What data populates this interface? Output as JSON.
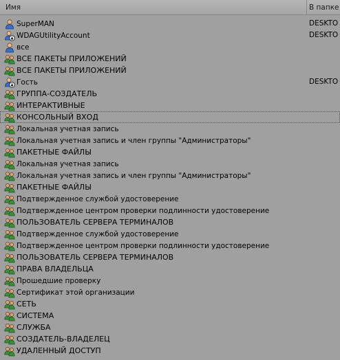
{
  "columns": {
    "name": "Имя",
    "folder": "В папке"
  },
  "rows": [
    {
      "name": "SuperMAN",
      "folder": "DESKTO",
      "icon": "user-icon"
    },
    {
      "name": "WDAGUtilityAccount",
      "folder": "DESKTO",
      "icon": "user-disabled-icon"
    },
    {
      "name": "все",
      "folder": "",
      "icon": "user-icon"
    },
    {
      "name": "ВСЕ ПАКЕТЫ ПРИЛОЖЕНИЙ",
      "folder": "",
      "icon": "group-icon"
    },
    {
      "name": "ВСЕ ПАКЕТЫ ПРИЛОЖЕНИЙ",
      "folder": "",
      "icon": "group-icon"
    },
    {
      "name": "Гость",
      "folder": "DESKTO",
      "icon": "user-disabled-icon"
    },
    {
      "name": "ГРУППА-СОЗДАТЕЛЬ",
      "folder": "",
      "icon": "group-icon"
    },
    {
      "name": "ИНТЕРАКТИВНЫЕ",
      "folder": "",
      "icon": "group-icon"
    },
    {
      "name": "КОНСОЛЬНЫЙ ВХОД",
      "folder": "",
      "icon": "group-icon"
    },
    {
      "name": "Локальная учетная запись",
      "folder": "",
      "icon": "group-icon"
    },
    {
      "name": "Локальная учетная запись и член группы \"Администраторы\"",
      "folder": "",
      "icon": "group-icon"
    },
    {
      "name": "ПАКЕТНЫЕ ФАЙЛЫ",
      "folder": "",
      "icon": "group-icon"
    },
    {
      "name": "Локальная учетная запись",
      "folder": "",
      "icon": "group-icon"
    },
    {
      "name": "Локальная учетная запись и член группы \"Администраторы\"",
      "folder": "",
      "icon": "group-icon"
    },
    {
      "name": "ПАКЕТНЫЕ ФАЙЛЫ",
      "folder": "",
      "icon": "group-icon"
    },
    {
      "name": "Подтвержденное службой удостоверение",
      "folder": "",
      "icon": "group-icon"
    },
    {
      "name": "Подтвержденное центром проверки подлинности удостоверение",
      "folder": "",
      "icon": "group-icon"
    },
    {
      "name": "ПОЛЬЗОВАТЕЛЬ СЕРВЕРА ТЕРМИНАЛОВ",
      "folder": "",
      "icon": "group-icon"
    },
    {
      "name": "Подтвержденное службой удостоверение",
      "folder": "",
      "icon": "group-icon"
    },
    {
      "name": "Подтвержденное центром проверки подлинности удостоверение",
      "folder": "",
      "icon": "group-icon"
    },
    {
      "name": "ПОЛЬЗОВАТЕЛЬ СЕРВЕРА ТЕРМИНАЛОВ",
      "folder": "",
      "icon": "group-icon"
    },
    {
      "name": "ПРАВА ВЛАДЕЛЬЦА",
      "folder": "",
      "icon": "group-icon"
    },
    {
      "name": "Прошедшие проверку",
      "folder": "",
      "icon": "group-icon"
    },
    {
      "name": "Сертификат этой организации",
      "folder": "",
      "icon": "group-icon"
    },
    {
      "name": "СЕТЬ",
      "folder": "",
      "icon": "group-icon"
    },
    {
      "name": "СИСТЕМА",
      "folder": "",
      "icon": "group-icon"
    },
    {
      "name": "СЛУЖБА",
      "folder": "",
      "icon": "group-icon"
    },
    {
      "name": "СОЗДАТЕЛЬ-ВЛАДЕЛЕЦ",
      "folder": "",
      "icon": "group-icon"
    },
    {
      "name": "УДАЛЕННЫЙ ДОСТУП",
      "folder": "",
      "icon": "group-icon"
    }
  ],
  "selected_index": 8
}
